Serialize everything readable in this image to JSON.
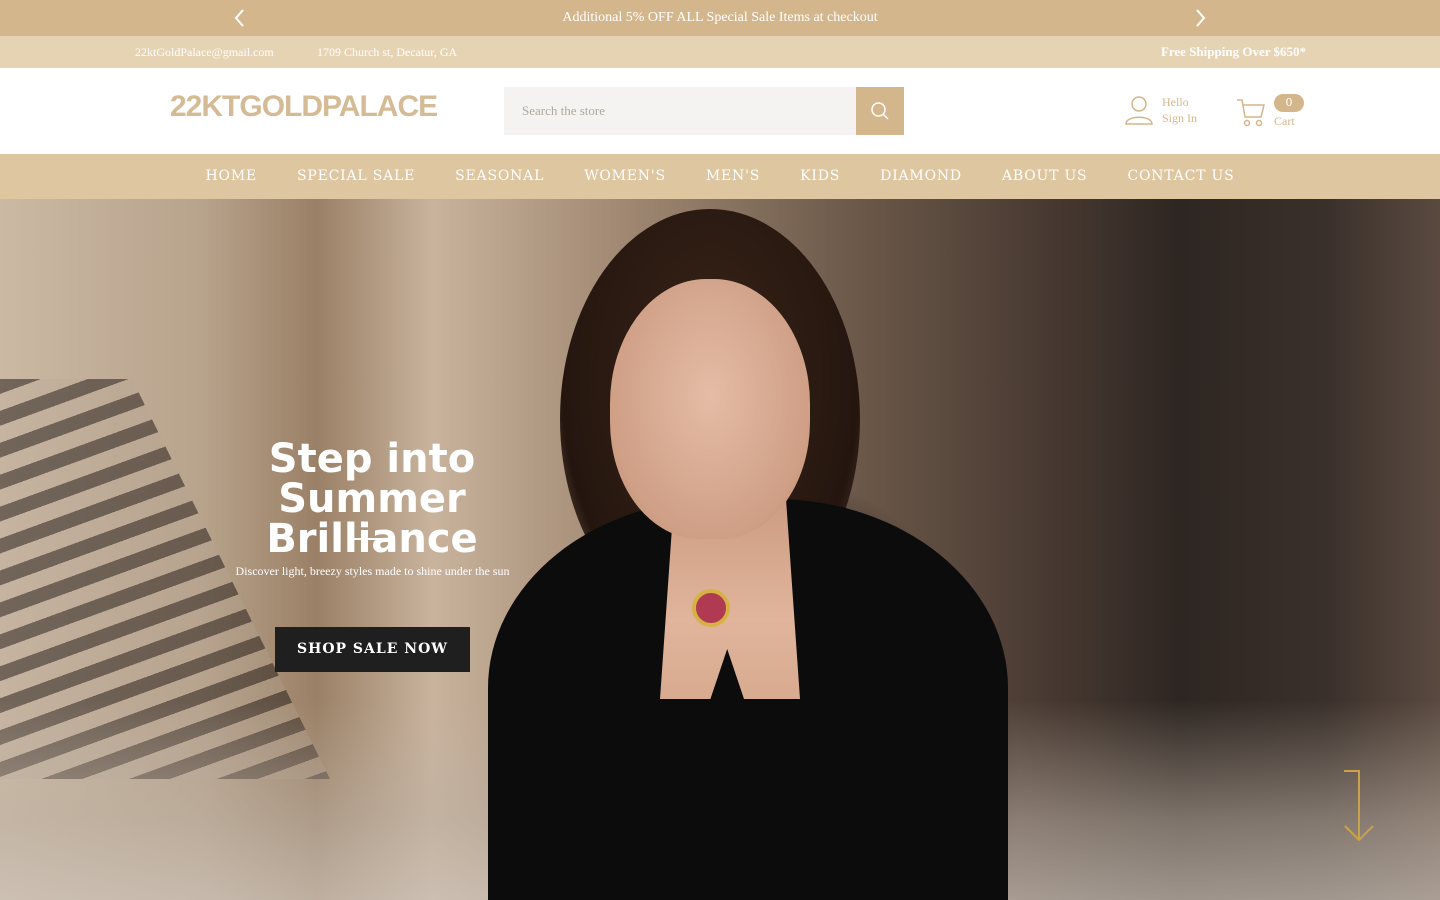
{
  "announcement": {
    "text": "Additional 5% OFF ALL Special Sale Items at checkout",
    "prev_icon": "chevron-left-icon",
    "next_icon": "chevron-right-icon"
  },
  "infobar": {
    "email": "22ktGoldPalace@gmail.com",
    "address": "1709 Church st, Decatur, GA",
    "shipping": "Free Shipping Over $650*"
  },
  "header": {
    "logo": "22KTGOLDPALACE",
    "search_placeholder": "Search the store",
    "search_icon": "search-icon",
    "account_greeting": "Hello",
    "account_action": "Sign In",
    "cart_count": "0",
    "cart_label": "Cart"
  },
  "nav": {
    "items": [
      "HOME",
      "SPECIAL SALE",
      "SEASONAL",
      "WOMEN'S",
      "MEN'S",
      "KIDS",
      "DIAMOND",
      "ABOUT US",
      "CONTACT US"
    ]
  },
  "hero": {
    "title": "Step into Summer Brilliance",
    "subtitle": "Discover light, breezy styles made to shine under the sun",
    "cta": "SHOP SALE NOW",
    "scroll_icon": "arrow-down-icon"
  },
  "colors": {
    "brand_gold": "#d4b68c",
    "infobar": "#e6d3b3",
    "nav": "#dec6a0",
    "button_dark": "#1f1f1f"
  }
}
